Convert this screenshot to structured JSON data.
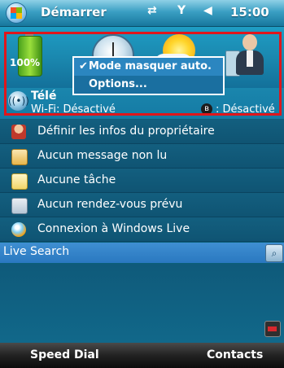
{
  "topbar": {
    "title": "Démarrer",
    "clock": "15:00",
    "icons": [
      "connectivity-icon",
      "signal-off-icon",
      "volume-icon"
    ]
  },
  "today": {
    "battery_percent": "100%",
    "icons": [
      "battery-icon",
      "clock-icon",
      "weather-icon",
      "contacts-icon"
    ]
  },
  "popup": {
    "items": [
      {
        "label": "Mode masquer auto.",
        "checked": true
      },
      {
        "label": "Options...",
        "checked": false
      }
    ]
  },
  "phone": {
    "name": "Télé",
    "wifi_status": "Wi-Fi: Désactivé",
    "bluetooth_status": ": Désactivé"
  },
  "list": {
    "items": [
      {
        "label": "Définir les infos du propriétaire",
        "icon": "owner-icon"
      },
      {
        "label": "Aucun message non lu",
        "icon": "mail-icon"
      },
      {
        "label": "Aucune tâche",
        "icon": "tasks-icon"
      },
      {
        "label": "Aucun rendez-vous prévu",
        "icon": "calendar-icon"
      },
      {
        "label": "Connexion à Windows Live",
        "icon": "windows-live-icon"
      }
    ]
  },
  "search": {
    "label": "Live Search"
  },
  "softkeys": {
    "left": "Speed Dial",
    "right": "Contacts"
  },
  "colors": {
    "highlight": "#e0161b",
    "accent": "#1a86ad",
    "popup_bg": "#1a6fa0"
  }
}
